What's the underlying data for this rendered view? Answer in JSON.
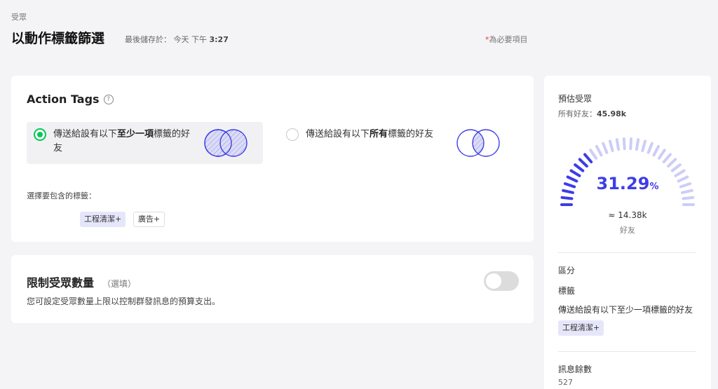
{
  "header": {
    "breadcrumb": "受眾",
    "title": "以動作標籤篩選",
    "save_status_label": "最後儲存於：",
    "save_status_day": "今天 下午",
    "save_status_time": "3:27",
    "required_star": "*",
    "required_text": "為必要項目"
  },
  "action_tags": {
    "title": "Action Tags",
    "help_icon": "?",
    "options": [
      {
        "pre": "傳送給設有以下",
        "bold": "至少一項",
        "post": "標籤的好友",
        "selected": true
      },
      {
        "pre": "傳送給設有以下",
        "bold": "所有",
        "post": "標籤的好友",
        "selected": false
      }
    ],
    "include_label": "選擇要包含的標籤：",
    "tags": [
      "工程清潔+",
      "廣告+"
    ]
  },
  "limit": {
    "title": "限制受眾數量",
    "optional": "（選填）",
    "description": "您可設定受眾數量上限以控制群發訊息的預算支出。",
    "toggle_on": false
  },
  "sidebar": {
    "estimate_title": "預估受眾",
    "all_friends_label": "所有好友：",
    "all_friends_value": "45.98k",
    "percent": "31.29",
    "percent_unit": "%",
    "percent_value": 31.29,
    "approx_count": "≈ 14.38k",
    "count_unit": "好友",
    "segment_title": "區分",
    "tag_label": "標籤",
    "tag_condition": "傳送給設有以下至少一項標籤的好友",
    "selected_tag": "工程清潔+",
    "message_count_label": "訊息餘數",
    "message_count_value": "527"
  },
  "colors": {
    "accent_green": "#06c755",
    "gauge_active": "#3d3de8",
    "gauge_inactive": "#cdcdf6",
    "tag_bg": "#e6e6fb"
  }
}
